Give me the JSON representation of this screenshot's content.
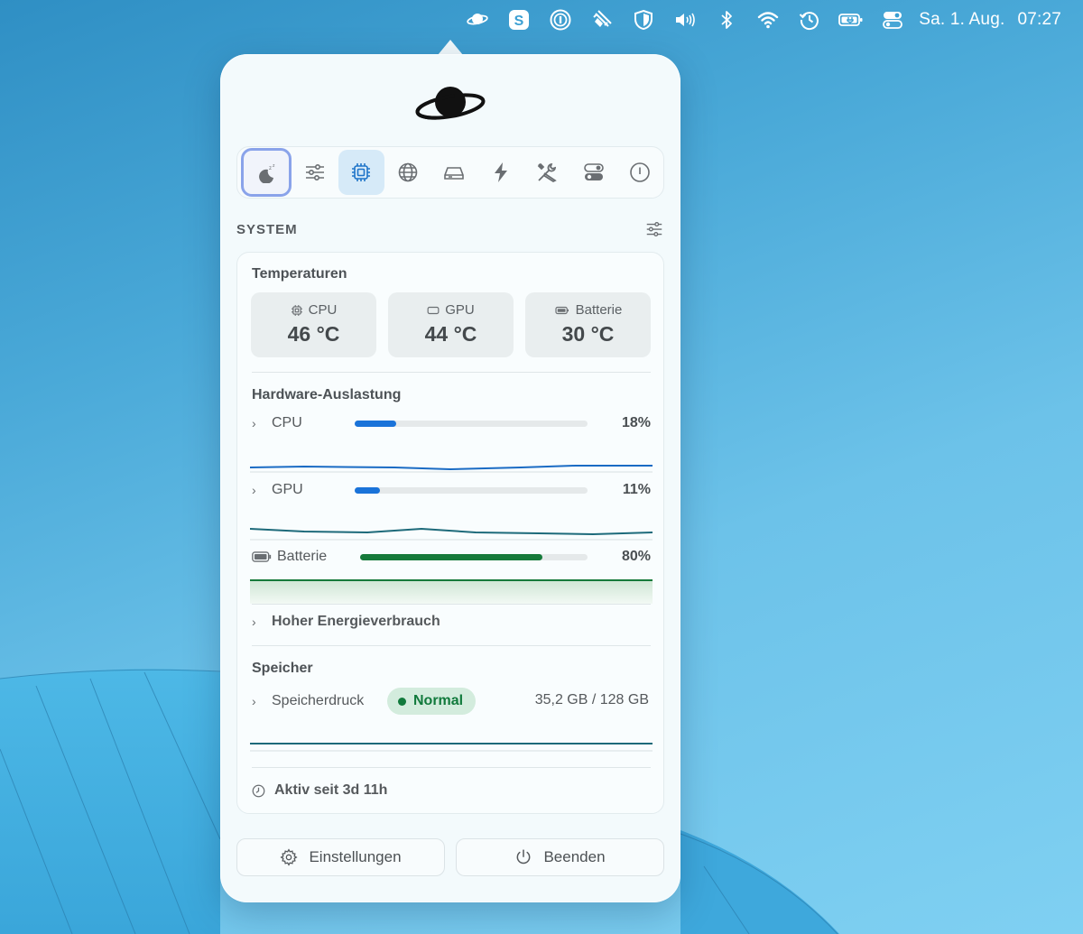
{
  "menubar": {
    "icons": [
      "saturn-icon",
      "s-app-icon",
      "1password-icon",
      "bolt-plug-icon",
      "shield-icon",
      "volume-icon",
      "bluetooth-icon",
      "wifi-icon",
      "time-machine-icon",
      "battery-charging-icon",
      "control-center-icon"
    ],
    "s_app_letter": "S",
    "date": "Sa. 1. Aug.",
    "time": "07:27"
  },
  "tabs": [
    {
      "icon": "sleep-icon",
      "state": "focused"
    },
    {
      "icon": "sliders-icon",
      "state": ""
    },
    {
      "icon": "cpu-chip-icon",
      "state": "active"
    },
    {
      "icon": "globe-icon",
      "state": ""
    },
    {
      "icon": "drive-icon",
      "state": ""
    },
    {
      "icon": "lightning-icon",
      "state": ""
    },
    {
      "icon": "tools-icon",
      "state": ""
    },
    {
      "icon": "toggles-icon",
      "state": ""
    },
    {
      "icon": "power-circle-icon",
      "state": ""
    }
  ],
  "section": {
    "title": "SYSTEM"
  },
  "temperatures": {
    "title": "Temperaturen",
    "items": [
      {
        "label": "CPU",
        "value": "46 °C",
        "icon": "cpu-chip-icon"
      },
      {
        "label": "GPU",
        "value": "44 °C",
        "icon": "gpu-card-icon"
      },
      {
        "label": "Batterie",
        "value": "30 °C",
        "icon": "battery-icon"
      }
    ]
  },
  "hardware": {
    "title": "Hardware-Auslastung",
    "cpu": {
      "label": "CPU",
      "pct_text": "18%",
      "fraction": 0.18,
      "color": "#1a73d9"
    },
    "gpu": {
      "label": "GPU",
      "pct_text": "11%",
      "fraction": 0.11,
      "color": "#1a73d9"
    },
    "battery": {
      "label": "Batterie",
      "pct_text": "80%",
      "fraction": 0.8,
      "color": "#167a3a"
    },
    "energy_link": "Hoher Energieverbrauch"
  },
  "memory": {
    "title": "Speicher",
    "pressure_label": "Speicherdruck",
    "pressure_status": "Normal",
    "usage": "35,2 GB / 128 GB"
  },
  "uptime": "Aktiv seit 3d 11h",
  "buttons": {
    "settings": "Einstellungen",
    "quit": "Beenden"
  },
  "colors": {
    "accent_blue": "#1f74c9",
    "status_green": "#117a3c",
    "sparkline_teal": "#1d6a7a"
  }
}
